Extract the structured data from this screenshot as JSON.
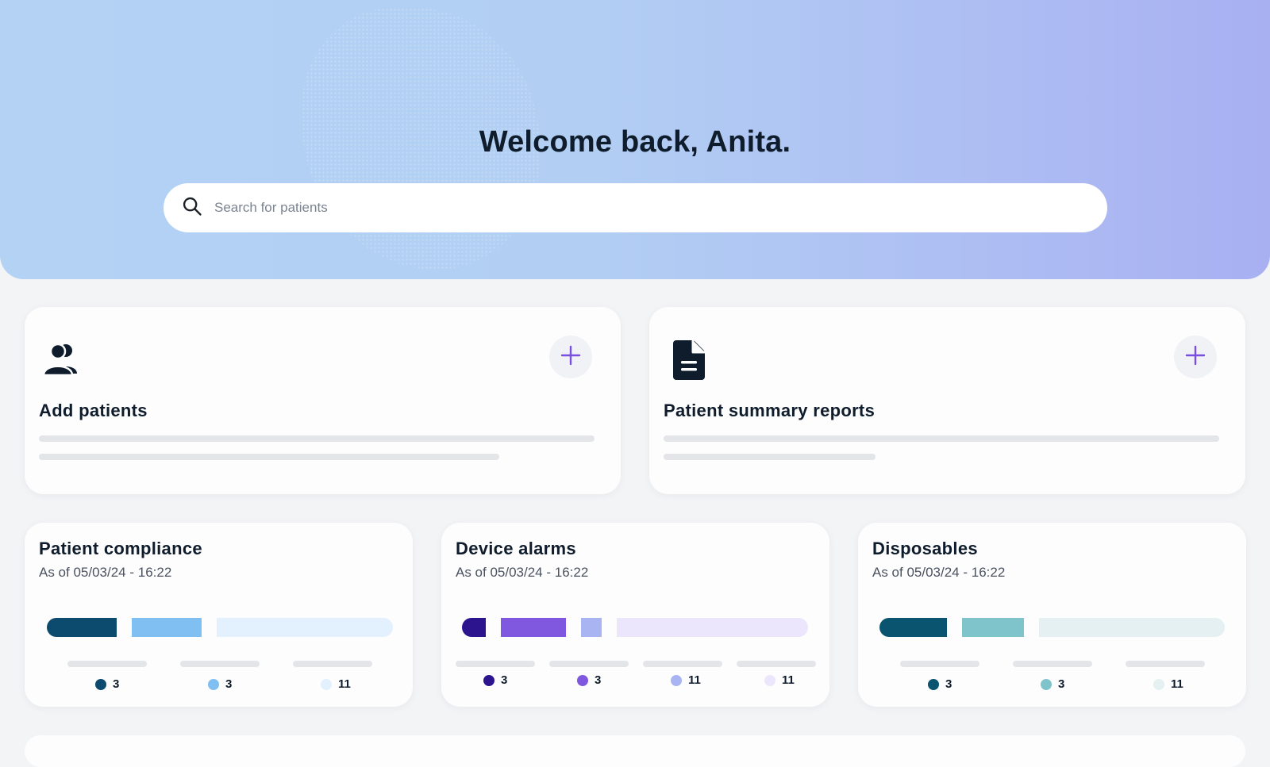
{
  "hero": {
    "title": "Welcome back, Anita.",
    "search_placeholder": "Search for patients"
  },
  "action_cards": [
    {
      "title": "Add patients",
      "icon": "users-icon",
      "action_icon": "plus-icon"
    },
    {
      "title": "Patient summary reports",
      "icon": "document-icon",
      "action_icon": "plus-icon"
    }
  ],
  "stats": [
    {
      "title": "Patient compliance",
      "subtitle": "As of 05/03/24 - 16:22",
      "segments": [
        {
          "value": 3,
          "color": "#0c4a6e"
        },
        {
          "value": 3,
          "color": "#7fbff2"
        },
        {
          "value": 11,
          "color": "#e3f0fd"
        }
      ]
    },
    {
      "title": "Device alarms",
      "subtitle": "As of 05/03/24 - 16:22",
      "segments": [
        {
          "value": 3,
          "color": "#2d148f"
        },
        {
          "value": 3,
          "color": "#8058e0"
        },
        {
          "value": 11,
          "color": "#a9b4f2"
        },
        {
          "value": 11,
          "color": "#ebe6fb"
        }
      ]
    },
    {
      "title": "Disposables",
      "subtitle": "As of 05/03/24 - 16:22",
      "segments": [
        {
          "value": 3,
          "color": "#0a5470"
        },
        {
          "value": 3,
          "color": "#80c4cb"
        },
        {
          "value": 11,
          "color": "#e4f0f1"
        }
      ]
    }
  ],
  "colors": {
    "accent": "#7a4fe0",
    "text": "#0f1c2b"
  }
}
